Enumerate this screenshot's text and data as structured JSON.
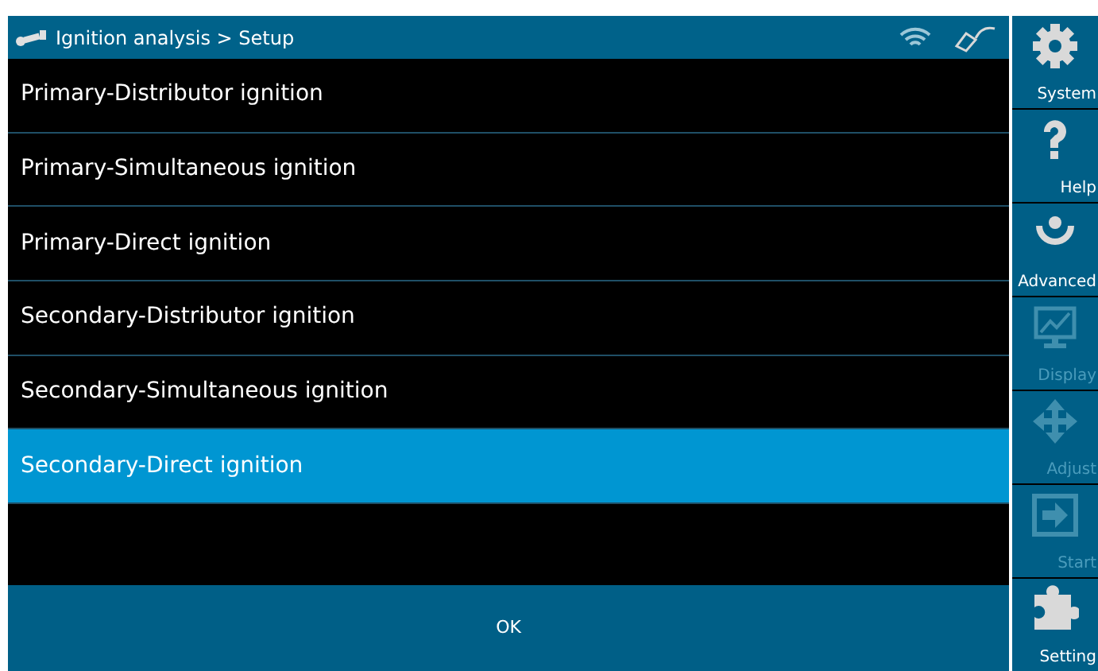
{
  "header": {
    "title": "Ignition analysis > Setup"
  },
  "items": [
    {
      "label": "Primary-Distributor ignition",
      "selected": false
    },
    {
      "label": "Primary-Simultaneous ignition",
      "selected": false
    },
    {
      "label": "Primary-Direct ignition",
      "selected": false
    },
    {
      "label": "Secondary-Distributor ignition",
      "selected": false
    },
    {
      "label": "Secondary-Simultaneous ignition",
      "selected": false
    },
    {
      "label": "Secondary-Direct ignition",
      "selected": true
    }
  ],
  "ok_button": "OK",
  "sidebar": [
    {
      "kind": "gear",
      "label": "System",
      "disabled": false
    },
    {
      "kind": "help",
      "label": "Help",
      "disabled": false
    },
    {
      "kind": "advanced",
      "label": "Advanced",
      "disabled": false
    },
    {
      "kind": "display",
      "label": "Display",
      "disabled": true
    },
    {
      "kind": "adjust",
      "label": "Adjust",
      "disabled": true
    },
    {
      "kind": "start",
      "label": "Start",
      "disabled": true
    },
    {
      "kind": "puzzle",
      "label": "Setting",
      "disabled": false
    }
  ]
}
